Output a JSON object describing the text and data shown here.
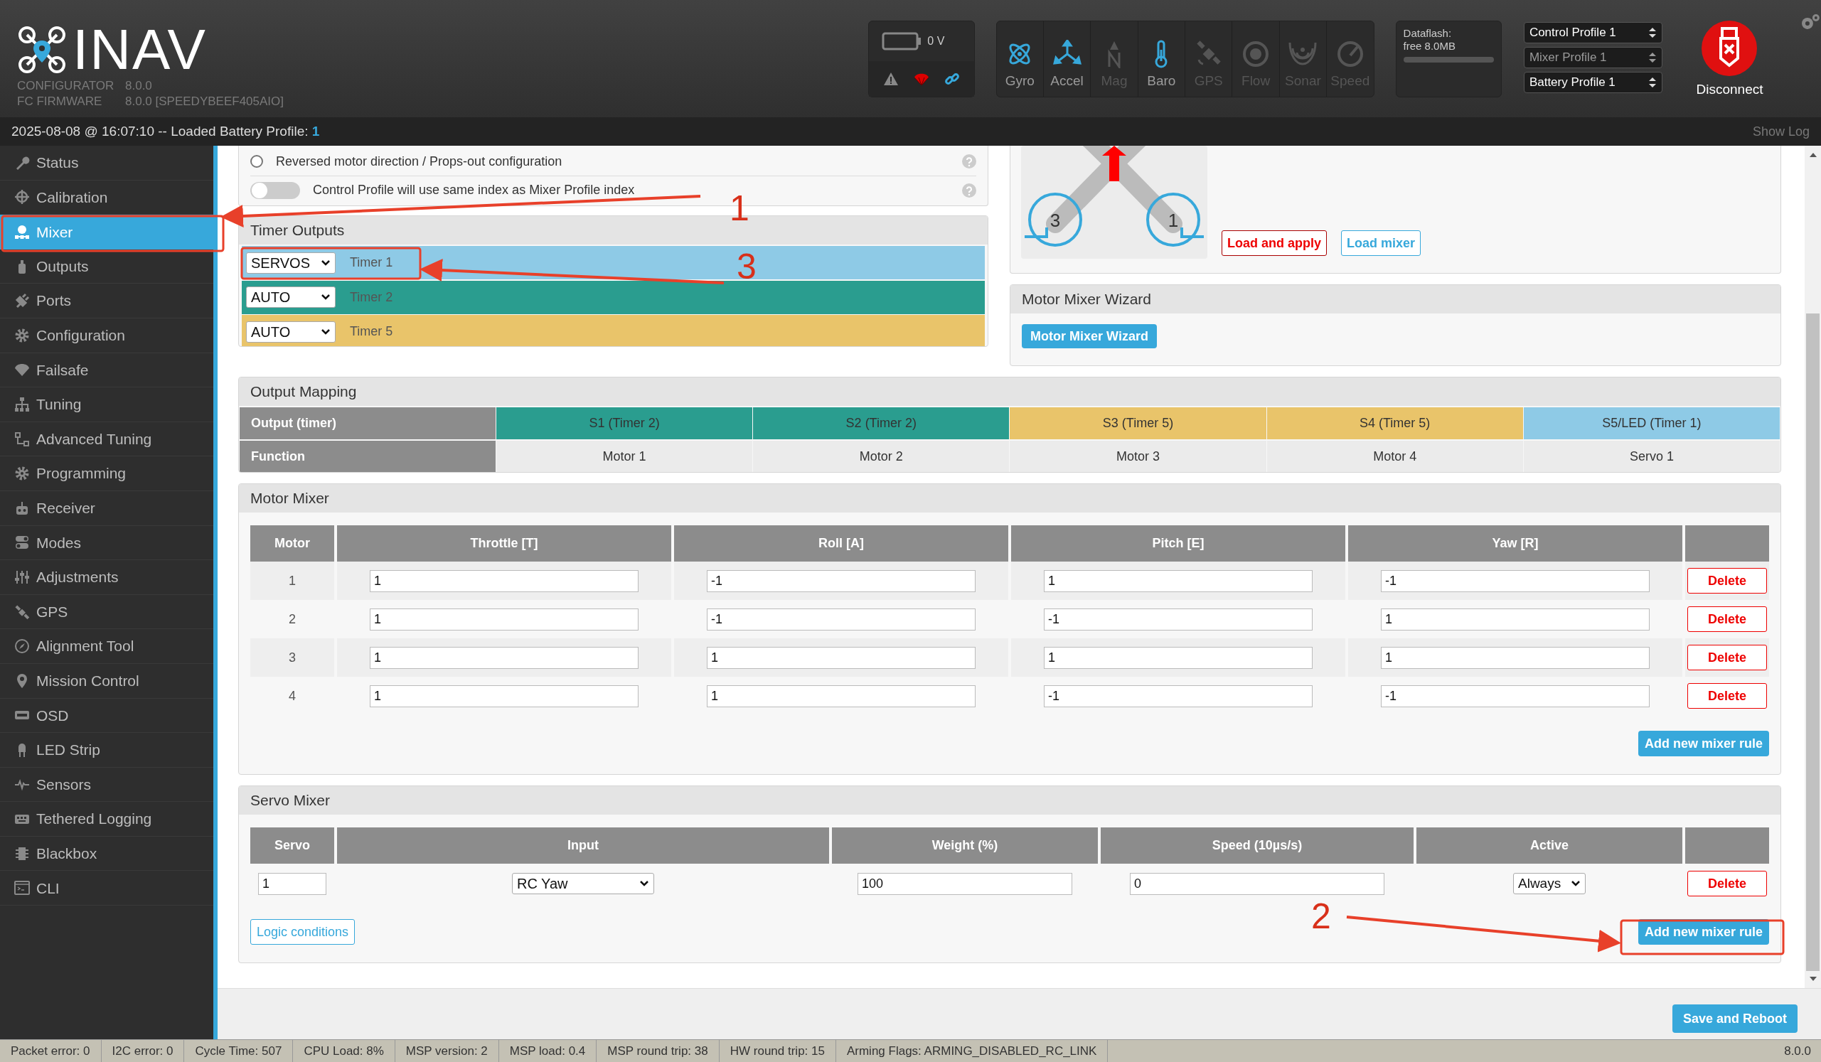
{
  "header": {
    "logo_text": "INAV",
    "versions": [
      {
        "label": "CONFIGURATOR",
        "value": "8.0.0"
      },
      {
        "label": "FC FIRMWARE",
        "value": "8.0.0 [SPEEDYBEEF405AIO]"
      }
    ],
    "battery": {
      "voltage": "0 V"
    },
    "sensors": [
      {
        "label": "Gyro",
        "active": true
      },
      {
        "label": "Accel",
        "active": true
      },
      {
        "label": "Mag",
        "active": false
      },
      {
        "label": "Baro",
        "active": true
      },
      {
        "label": "GPS",
        "active": false
      },
      {
        "label": "Flow",
        "active": false
      },
      {
        "label": "Sonar",
        "active": false
      },
      {
        "label": "Speed",
        "active": false
      }
    ],
    "dataflash": {
      "label": "Dataflash:",
      "free": "free 8.0MB",
      "level": 0
    },
    "profiles": [
      {
        "label": "Control Profile 1",
        "disabled": false
      },
      {
        "label": "Mixer Profile 1",
        "disabled": true
      },
      {
        "label": "Battery Profile 1",
        "disabled": false
      }
    ],
    "disconnect": "Disconnect"
  },
  "log_bar": {
    "message": "2025-08-08 @ 16:07:10 -- Loaded Battery Profile:",
    "value": "1",
    "show_log": "Show Log"
  },
  "sidebar": {
    "items": [
      {
        "label": "Status",
        "selected": false
      },
      {
        "label": "Calibration",
        "selected": false
      },
      {
        "label": "Mixer",
        "selected": true
      },
      {
        "label": "Outputs",
        "selected": false
      },
      {
        "label": "Ports",
        "selected": false
      },
      {
        "label": "Configuration",
        "selected": false
      },
      {
        "label": "Failsafe",
        "selected": false
      },
      {
        "label": "Tuning",
        "selected": false
      },
      {
        "label": "Advanced Tuning",
        "selected": false
      },
      {
        "label": "Programming",
        "selected": false
      },
      {
        "label": "Receiver",
        "selected": false
      },
      {
        "label": "Modes",
        "selected": false
      },
      {
        "label": "Adjustments",
        "selected": false
      },
      {
        "label": "GPS",
        "selected": false
      },
      {
        "label": "Alignment Tool",
        "selected": false
      },
      {
        "label": "Mission Control",
        "selected": false
      },
      {
        "label": "OSD",
        "selected": false
      },
      {
        "label": "LED Strip",
        "selected": false
      },
      {
        "label": "Sensors",
        "selected": false
      },
      {
        "label": "Tethered Logging",
        "selected": false
      },
      {
        "label": "Blackbox",
        "selected": false
      },
      {
        "label": "CLI",
        "selected": false
      }
    ]
  },
  "options": [
    {
      "kind": "radio",
      "label": "Reversed motor direction / Props-out configuration",
      "on": false
    },
    {
      "kind": "toggle",
      "label": "Control Profile will use same index as Mixer Profile index",
      "on": false
    }
  ],
  "timer_outputs": {
    "title": "Timer Outputs",
    "rows": [
      {
        "mode": "SERVOS",
        "timer": "Timer 1",
        "color": "#8ecae6"
      },
      {
        "mode": "AUTO",
        "timer": "Timer 2",
        "color": "#2a9d8f"
      },
      {
        "mode": "AUTO",
        "timer": "Timer 5",
        "color": "#e9c46a"
      }
    ]
  },
  "preview": {
    "motors": [
      "3",
      "1"
    ],
    "buttons": [
      {
        "label": "Load and apply",
        "kind": "danger"
      },
      {
        "label": "Load mixer",
        "kind": "outline"
      }
    ]
  },
  "wizard": {
    "title": "Motor Mixer Wizard",
    "button": "Motor Mixer Wizard"
  },
  "output_mapping": {
    "title": "Output Mapping",
    "output_label": "Output (timer)",
    "function_label": "Function",
    "outputs": [
      {
        "output": "S1 (Timer 2)",
        "function": "Motor 1",
        "color": "#2a9d8f"
      },
      {
        "output": "S2 (Timer 2)",
        "function": "Motor 2",
        "color": "#2a9d8f"
      },
      {
        "output": "S3 (Timer 5)",
        "function": "Motor 3",
        "color": "#e9c46a"
      },
      {
        "output": "S4 (Timer 5)",
        "function": "Motor 4",
        "color": "#e9c46a"
      },
      {
        "output": "S5/LED (Timer 1)",
        "function": "Servo 1",
        "color": "#8ecae6"
      }
    ]
  },
  "motor_mixer": {
    "title": "Motor Mixer",
    "columns": [
      "Motor",
      "Throttle [T]",
      "Roll [A]",
      "Pitch [E]",
      "Yaw [R]"
    ],
    "rows": [
      {
        "motor": "1",
        "values": [
          "1",
          "-1",
          "1",
          "-1"
        ],
        "delete": "Delete"
      },
      {
        "motor": "2",
        "values": [
          "1",
          "-1",
          "-1",
          "1"
        ],
        "delete": "Delete"
      },
      {
        "motor": "3",
        "values": [
          "1",
          "1",
          "1",
          "1"
        ],
        "delete": "Delete"
      },
      {
        "motor": "4",
        "values": [
          "1",
          "1",
          "-1",
          "-1"
        ],
        "delete": "Delete"
      }
    ],
    "add_button": "Add new mixer rule"
  },
  "servo_mixer": {
    "title": "Servo Mixer",
    "columns": [
      "Servo",
      "Input",
      "Weight (%)",
      "Speed (10µs/s)",
      "Active"
    ],
    "rows": [
      {
        "servo": "1",
        "input": "RC Yaw",
        "weight": "100",
        "speed": "0",
        "active": "Always",
        "delete": "Delete"
      }
    ],
    "logic_button": "Logic conditions",
    "add_button": "Add new mixer rule"
  },
  "save_button": "Save and Reboot",
  "status_bar": {
    "items": [
      "Packet error: 0",
      "I2C error: 0",
      "Cycle Time: 507",
      "CPU Load: 8%",
      "MSP version: 2",
      "MSP load: 0.4",
      "MSP round trip: 38",
      "HW round trip: 15",
      "Arming Flags: ARMING_DISABLED_RC_LINK"
    ],
    "version": "8.0.0"
  },
  "annotations": [
    {
      "label": "1"
    },
    {
      "label": "2"
    },
    {
      "label": "3"
    }
  ]
}
